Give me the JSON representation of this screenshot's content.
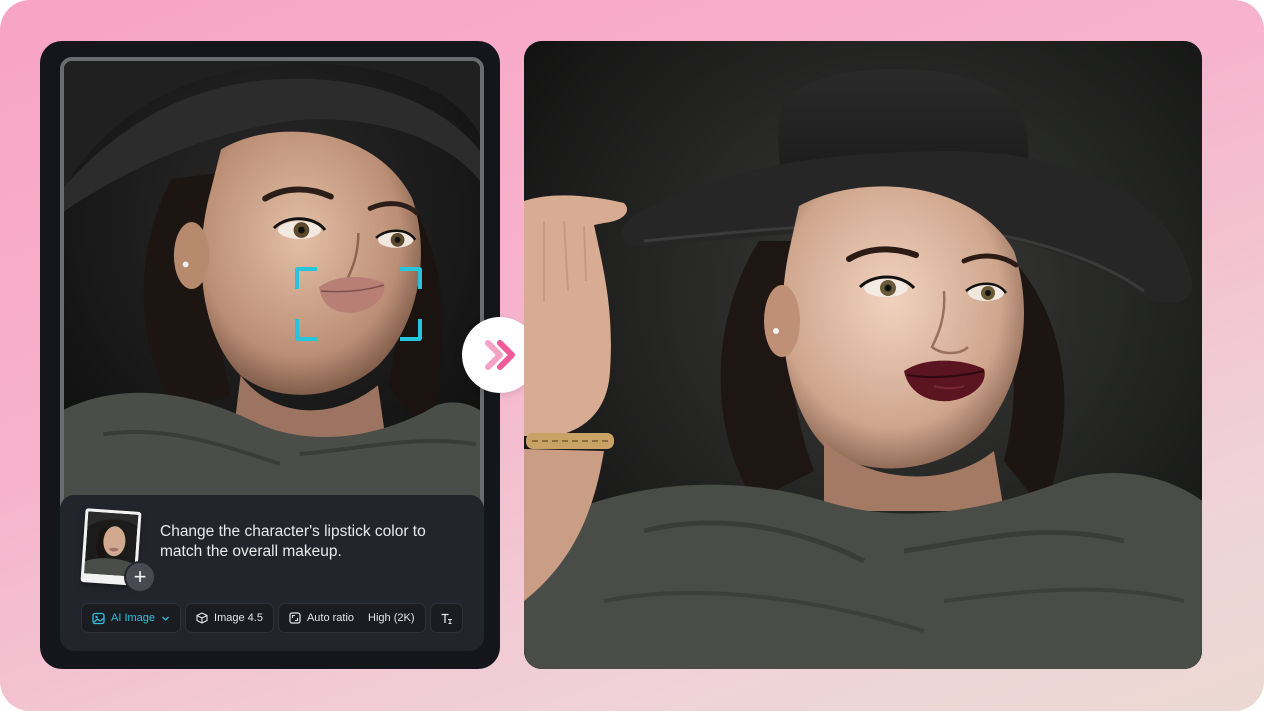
{
  "prompt": {
    "text": "Change the character's lipstick color to match the overall makeup."
  },
  "toolbar": {
    "mode_label": "AI Image",
    "model_label": "Image 4.5",
    "ratio_label": "Auto ratio",
    "quality_label": "High (2K)"
  },
  "icons": {
    "mode": "image-icon",
    "dropdown": "chevron-down-icon",
    "model": "cube-icon",
    "ratio": "aspect-ratio-icon",
    "text_style": "text-style-icon",
    "add": "plus-icon",
    "proceed": "double-chevron-right-icon"
  },
  "colors": {
    "accent_cyan": "#27c4dd",
    "accent_pink": "#f05a9b",
    "panel_bg": "#15161b",
    "card_bg": "#23252d",
    "lip_before": "#b77f76",
    "lip_after": "#5a1520"
  }
}
